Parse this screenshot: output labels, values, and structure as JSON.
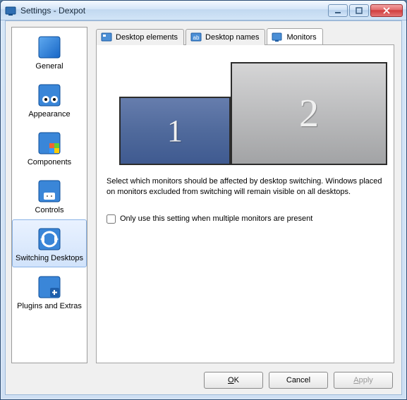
{
  "window": {
    "title": "Settings - Dexpot"
  },
  "sidebar": {
    "items": [
      {
        "label": "General"
      },
      {
        "label": "Appearance"
      },
      {
        "label": "Components"
      },
      {
        "label": "Controls"
      },
      {
        "label": "Switching Desktops"
      },
      {
        "label": "Plugins and Extras"
      }
    ],
    "selected_index": 4
  },
  "tabs": {
    "items": [
      {
        "label": "Desktop elements"
      },
      {
        "label": "Desktop names"
      },
      {
        "label": "Monitors"
      }
    ],
    "active_index": 2
  },
  "monitors": {
    "display": [
      {
        "number": "1",
        "selected": true
      },
      {
        "number": "2",
        "selected": false
      }
    ],
    "description": "Select which monitors should be affected by desktop switching. Windows placed on monitors excluded from switching will remain visible on all desktops.",
    "checkbox_label": "Only use this setting when multiple monitors are present",
    "checkbox_checked": false
  },
  "buttons": {
    "ok": "OK",
    "cancel": "Cancel",
    "apply": "Apply"
  }
}
